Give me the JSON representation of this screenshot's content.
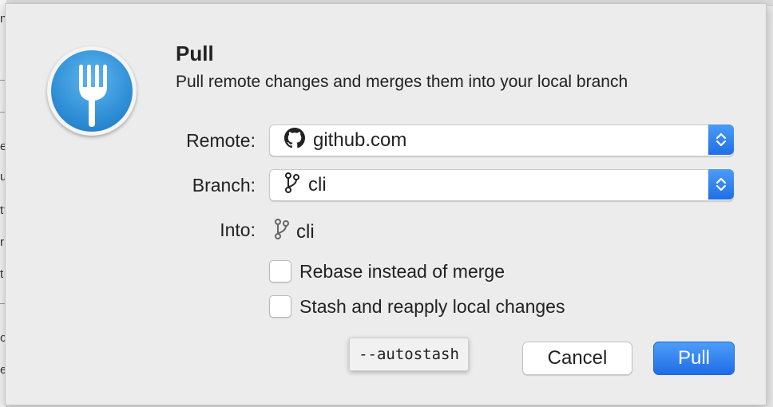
{
  "dialog": {
    "title": "Pull",
    "subtitle": "Pull remote changes and merges them into your local branch",
    "icon": "fork-icon"
  },
  "remote": {
    "label": "Remote:",
    "value": "github.com",
    "icon": "github-icon"
  },
  "branch": {
    "label": "Branch:",
    "value": "cli",
    "icon": "branch-icon"
  },
  "into": {
    "label": "Into:",
    "value": "cli",
    "icon": "branch-icon"
  },
  "options": {
    "rebase": {
      "label": "Rebase instead of merge",
      "checked": false
    },
    "stash": {
      "label": "Stash and reapply local changes",
      "checked": false
    }
  },
  "tooltip": {
    "text": "--autostash"
  },
  "buttons": {
    "cancel": "Cancel",
    "pull": "Pull"
  },
  "colors": {
    "accent": "#1f6fe6",
    "icon_blue": "#2f8fd6"
  },
  "background": {
    "chars": [
      "n",
      "e",
      "u",
      "t",
      "r",
      "t",
      "o",
      "e"
    ]
  }
}
